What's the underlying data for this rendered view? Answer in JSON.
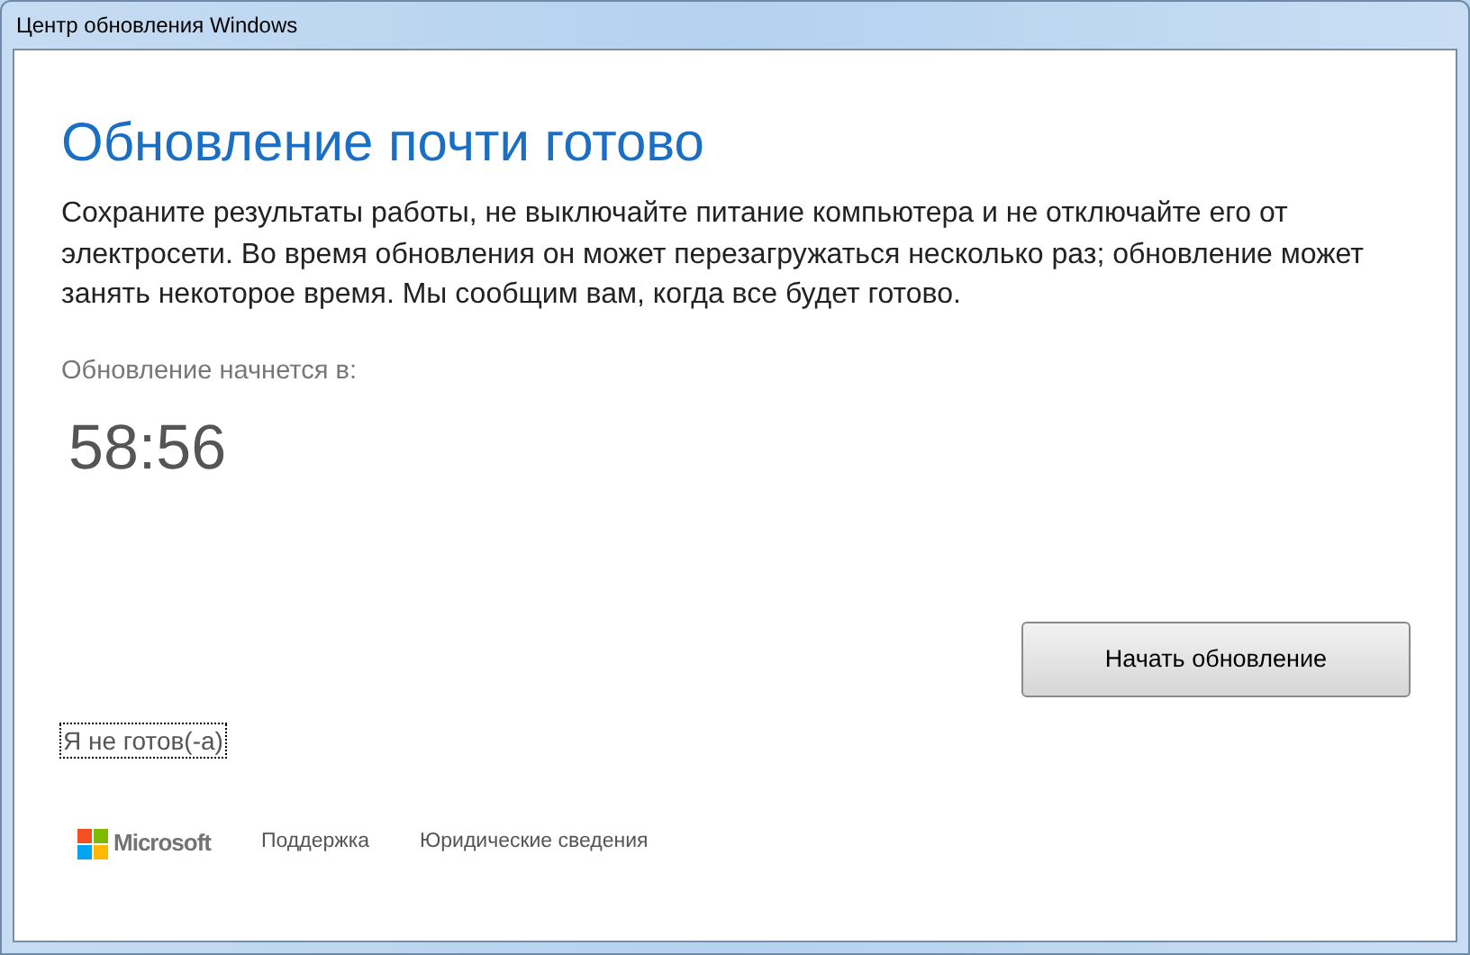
{
  "window": {
    "title": "Центр обновления Windows"
  },
  "heading": "Обновление почти готово",
  "message": "Сохраните результаты работы, не выключайте питание компьютера и не отключайте его от электросети. Во время обновления он может перезагружаться несколько раз; обновление может занять некоторое время. Мы сообщим вам, когда все будет готово.",
  "countdown": {
    "label": "Обновление начнется в:",
    "time": "58:56"
  },
  "start_button": "Начать обновление",
  "not_ready_link": {
    "label": "Я не готов(-а)",
    "focused": true
  },
  "footer": {
    "brand": "Microsoft",
    "links": [
      "Поддержка",
      "Юридические сведения"
    ]
  }
}
